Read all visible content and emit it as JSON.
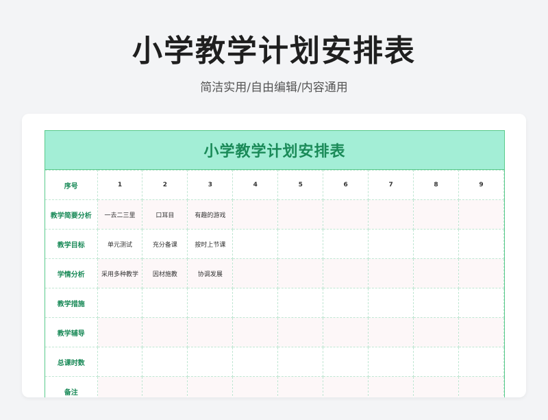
{
  "page": {
    "title": "小学教学计划安排表",
    "subtitle": "简洁实用/自由编辑/内容通用"
  },
  "sheet": {
    "title": "小学教学计划安排表",
    "header": {
      "label": "序号",
      "numbers": [
        "1",
        "2",
        "3",
        "4",
        "5",
        "6",
        "7",
        "8",
        "9"
      ]
    },
    "rows": [
      {
        "label": "教学简要分析",
        "cells": [
          "一去二三里",
          "口耳目",
          "有趣的游戏",
          "",
          "",
          "",
          "",
          "",
          ""
        ]
      },
      {
        "label": "教学目标",
        "cells": [
          "单元测试",
          "充分备课",
          "按时上节课",
          "",
          "",
          "",
          "",
          "",
          ""
        ]
      },
      {
        "label": "学情分析",
        "cells": [
          "采用多种教学",
          "因材施教",
          "协调发展",
          "",
          "",
          "",
          "",
          "",
          ""
        ]
      },
      {
        "label": "教学措施",
        "cells": [
          "",
          "",
          "",
          "",
          "",
          "",
          "",
          "",
          ""
        ]
      },
      {
        "label": "教学辅导",
        "cells": [
          "",
          "",
          "",
          "",
          "",
          "",
          "",
          "",
          ""
        ]
      },
      {
        "label": "总课时数",
        "cells": [
          "",
          "",
          "",
          "",
          "",
          "",
          "",
          "",
          ""
        ]
      },
      {
        "label": "备注",
        "cells": [
          "",
          "",
          "",
          "",
          "",
          "",
          "",
          "",
          ""
        ]
      }
    ]
  }
}
